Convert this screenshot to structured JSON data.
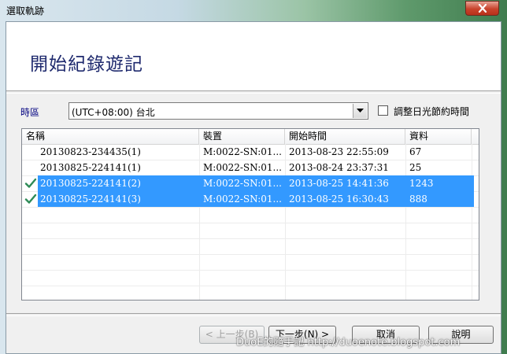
{
  "window": {
    "title": "選取軌跡"
  },
  "header": {
    "title": "開始紀錄遊記"
  },
  "timezone": {
    "label": "時區",
    "selected": "(UTC+08:00) 台北",
    "dst_label": "調整日光節約時間",
    "dst_checked": false
  },
  "list": {
    "columns": [
      "名稱",
      "裝置",
      "開始時間",
      "資料"
    ],
    "rows": [
      {
        "name": "20130823-234435(1)",
        "device": "M:0022-SN:01...",
        "start": "2013-08-23 22:55:09",
        "count": "67",
        "checked": false,
        "selected": false
      },
      {
        "name": "20130825-224141(1)",
        "device": "M:0022-SN:01...",
        "start": "2013-08-24 23:37:31",
        "count": "25",
        "checked": false,
        "selected": false
      },
      {
        "name": "20130825-224141(2)",
        "device": "M:0022-SN:01...",
        "start": "2013-08-25 14:41:36",
        "count": "1243",
        "checked": true,
        "selected": true
      },
      {
        "name": "20130825-224141(3)",
        "device": "M:0022-SN:01...",
        "start": "2013-08-25 16:30:43",
        "count": "888",
        "checked": true,
        "selected": true
      }
    ]
  },
  "buttons": {
    "back": "< 上一步(B)",
    "next": "下一步(N) >",
    "cancel": "取消",
    "help": "說明"
  },
  "watermark": "DuoE的隨手記 http://duoenote.blogspot.com",
  "colors": {
    "selection": "#3399ff",
    "header_title": "#1f2a6e",
    "check": "#2e8b57"
  }
}
